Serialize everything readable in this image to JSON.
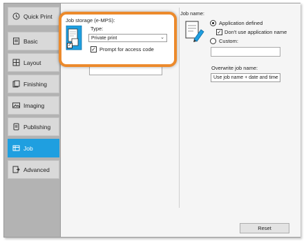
{
  "sidebar": {
    "items": [
      {
        "label": "Quick Print",
        "icon": "clock-icon"
      },
      {
        "label": "Basic",
        "icon": "document-icon"
      },
      {
        "label": "Layout",
        "icon": "layout-grid-icon"
      },
      {
        "label": "Finishing",
        "icon": "finishing-icon"
      },
      {
        "label": "Imaging",
        "icon": "image-icon"
      },
      {
        "label": "Publishing",
        "icon": "publishing-icon"
      },
      {
        "label": "Job",
        "icon": "job-icon"
      },
      {
        "label": "Advanced",
        "icon": "advanced-icon"
      }
    ],
    "active_label": "Job"
  },
  "job_storage": {
    "title": "Job storage (e-MPS):",
    "type_label": "Type:",
    "type_value": "Private print",
    "prompt_label": "Prompt for access code",
    "prompt_checked": true,
    "enabled_checked": true
  },
  "job_name": {
    "title": "Job name:",
    "option_app_defined": "Application defined",
    "option_dont_use": "Don't use application name",
    "option_custom": "Custom:",
    "custom_value": "",
    "overwrite_label": "Overwrite job name:",
    "overwrite_value": "Use job name + date and time"
  },
  "footer": {
    "reset_label": "Reset"
  },
  "colors": {
    "accent": "#1f9fe0",
    "highlight": "#ec8a2c",
    "sidebar_bg": "#b3b3b3"
  }
}
